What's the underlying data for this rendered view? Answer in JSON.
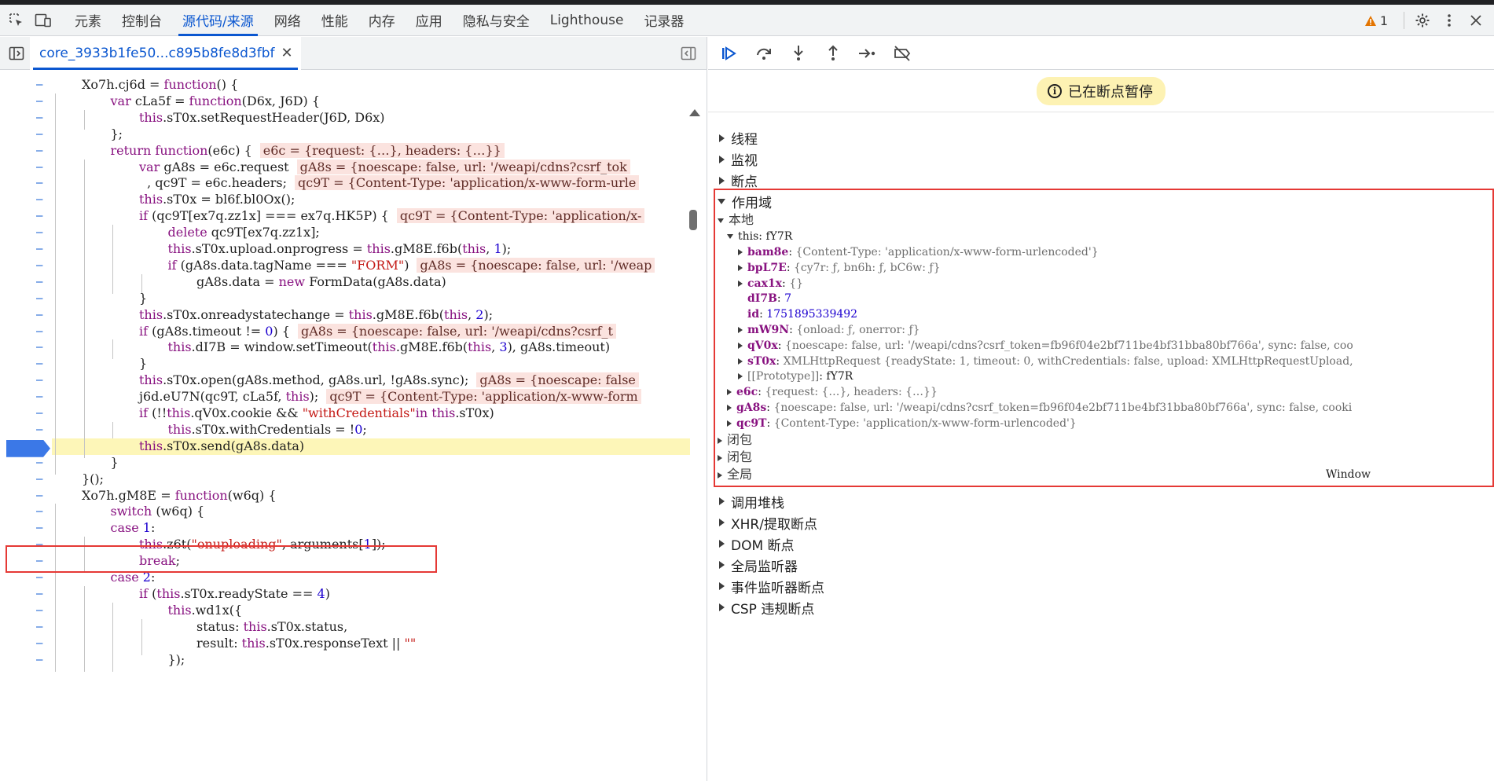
{
  "tabs": [
    "元素",
    "控制台",
    "源代码/来源",
    "网络",
    "性能",
    "内存",
    "应用",
    "隐私与安全",
    "Lighthouse",
    "记录器"
  ],
  "active_tab_index": 2,
  "warning_count": "1",
  "file_tab": "core_3933b1fe50...c895b8fe8d3fbf",
  "paused_label": "已在断点暂停",
  "sections_top": [
    "线程",
    "监视",
    "断点"
  ],
  "scope_section": "作用域",
  "sections_bottom": [
    "调用堆栈",
    "XHR/提取断点",
    "DOM 断点",
    "全局监听器",
    "事件监听器断点",
    "CSP 违规断点"
  ],
  "scope": {
    "local_label": "本地",
    "this_row": "this: fY7R",
    "props": [
      {
        "key": "bam8e",
        "val": "{Content-Type: 'application/x-www-form-urlencoded'}"
      },
      {
        "key": "bpL7E",
        "val": "{cy7r: ƒ, bn6h: ƒ, bC6w: ƒ}"
      },
      {
        "key": "cax1x",
        "val": "{}"
      },
      {
        "key": "dI7B",
        "val": "7"
      },
      {
        "key": "id",
        "val": "1751895339492"
      },
      {
        "key": "mW9N",
        "val": "{onload: ƒ, onerror: ƒ}"
      },
      {
        "key": "qV0x",
        "val": "{noescape: false, url: '/weapi/cdns?csrf_token=fb96f04e2bf711be4bf31bba80bf766a', sync: false, coo"
      },
      {
        "key": "sT0x",
        "val": "XMLHttpRequest  {readyState: 1, timeout: 0, withCredentials: false, upload: XMLHttpRequestUpload,"
      },
      {
        "key": "[[Prototype]]",
        "val": "fY7R"
      }
    ],
    "locals": [
      {
        "key": "e6c",
        "val": "{request: {…}, headers: {…}}"
      },
      {
        "key": "gA8s",
        "val": "{noescape: false, url: '/weapi/cdns?csrf_token=fb96f04e2bf711be4bf31bba80bf766a', sync: false, cooki"
      },
      {
        "key": "qc9T",
        "val": "{Content-Type: 'application/x-www-form-urlencoded'}"
      }
    ],
    "closure1": "闭包",
    "closure2": "闭包",
    "global": "全局",
    "global_value": "Window"
  },
  "code_lines": [
    {
      "indent": 0,
      "text": "Xo7h.cj6d = function() {"
    },
    {
      "indent": 1,
      "text": "var cLa5f = function(D6x, J6D) {"
    },
    {
      "indent": 2,
      "text": "this.sT0x.setRequestHeader(J6D, D6x)"
    },
    {
      "indent": 1,
      "text": "};"
    },
    {
      "indent": 1,
      "text": "return function(e6c) {",
      "inline": "e6c = {request: {…}, headers: {…}}"
    },
    {
      "indent": 2,
      "text": "var gA8s = e6c.request",
      "inline": "gA8s = {noescape: false, url: '/weapi/cdns?csrf_tok"
    },
    {
      "indent": 2,
      "text": "  , qc9T = e6c.headers;",
      "inline": "qc9T = {Content-Type: 'application/x-www-form-urle"
    },
    {
      "indent": 2,
      "text": "this.sT0x = bl6f.bl0Ox();"
    },
    {
      "indent": 2,
      "text": "if (qc9T[ex7q.zz1x] === ex7q.HK5P) {",
      "inline": "qc9T = {Content-Type: 'application/x-"
    },
    {
      "indent": 3,
      "text": "delete qc9T[ex7q.zz1x];"
    },
    {
      "indent": 3,
      "text": "this.sT0x.upload.onprogress = this.gM8E.f6b(this, 1);"
    },
    {
      "indent": 3,
      "text": "if (gA8s.data.tagName === \"FORM\")",
      "inline": "gA8s = {noescape: false, url: '/weap"
    },
    {
      "indent": 4,
      "text": "gA8s.data = new FormData(gA8s.data)"
    },
    {
      "indent": 2,
      "text": "}"
    },
    {
      "indent": 2,
      "text": "this.sT0x.onreadystatechange = this.gM8E.f6b(this, 2);"
    },
    {
      "indent": 2,
      "text": "if (gA8s.timeout != 0) {",
      "inline": "gA8s = {noescape: false, url: '/weapi/cdns?csrf_t"
    },
    {
      "indent": 3,
      "text": "this.dI7B = window.setTimeout(this.gM8E.f6b(this, 3), gA8s.timeout)"
    },
    {
      "indent": 2,
      "text": "}"
    },
    {
      "indent": 2,
      "text": "this.sT0x.open(gA8s.method, gA8s.url, !gA8s.sync);",
      "inline": "gA8s = {noescape: false"
    },
    {
      "indent": 2,
      "text": "j6d.eU7N(qc9T, cLa5f, this);",
      "inline": "qc9T = {Content-Type: 'application/x-www-form"
    },
    {
      "indent": 2,
      "text": "if (!!this.qV0x.cookie && \"withCredentials\"in this.sT0x)"
    },
    {
      "indent": 3,
      "text": "this.sT0x.withCredentials = !0;"
    },
    {
      "indent": 2,
      "text": "this.sT0x.send(gA8s.data)",
      "current": true
    },
    {
      "indent": 1,
      "text": "}"
    },
    {
      "indent": 0,
      "text": "}();"
    },
    {
      "indent": 0,
      "text": "Xo7h.gM8E = function(w6q) {"
    },
    {
      "indent": 1,
      "text": "switch (w6q) {"
    },
    {
      "indent": 1,
      "text": "case 1:"
    },
    {
      "indent": 2,
      "text": "this.z6t(\"onuploading\", arguments[1]);"
    },
    {
      "indent": 2,
      "text": "break;"
    },
    {
      "indent": 1,
      "text": "case 2:"
    },
    {
      "indent": 2,
      "text": "if (this.sT0x.readyState == 4)"
    },
    {
      "indent": 3,
      "text": "this.wd1x({"
    },
    {
      "indent": 4,
      "text": "status: this.sT0x.status,"
    },
    {
      "indent": 4,
      "text": "result: this.sT0x.responseText || \"\""
    },
    {
      "indent": 3,
      "text": "});"
    }
  ]
}
